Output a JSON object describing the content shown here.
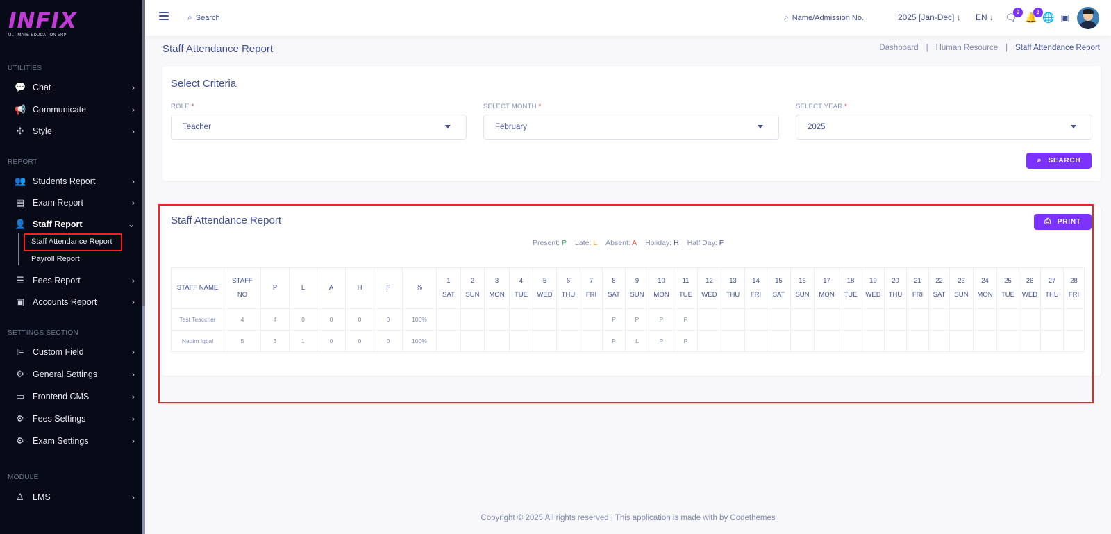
{
  "brand": {
    "logo": "INFIX",
    "tagline": "ULTIMATE EDUCATION ERP",
    "accent": "#7c32ff"
  },
  "sidebar": {
    "sections": {
      "utilities": "UTILITIES",
      "report": "REPORT",
      "settings": "SETTINGS SECTION",
      "module": "MODULE"
    },
    "items": [
      {
        "label": "Chat",
        "icon": "chat-icon"
      },
      {
        "label": "Communicate",
        "icon": "megaphone-icon"
      },
      {
        "label": "Style",
        "icon": "style-icon"
      },
      {
        "label": "Students Report",
        "icon": "users-icon"
      },
      {
        "label": "Exam Report",
        "icon": "book-icon"
      },
      {
        "label": "Staff Report",
        "icon": "user-icon"
      },
      {
        "label": "Fees Report",
        "icon": "fees-icon"
      },
      {
        "label": "Accounts Report",
        "icon": "money-icon"
      },
      {
        "label": "Custom Field",
        "icon": "custom-field-icon"
      },
      {
        "label": "General Settings",
        "icon": "gears-icon"
      },
      {
        "label": "Frontend CMS",
        "icon": "monitor-icon"
      },
      {
        "label": "Fees Settings",
        "icon": "gears-icon"
      },
      {
        "label": "Exam Settings",
        "icon": "gears-icon"
      },
      {
        "label": "LMS",
        "icon": "lms-icon"
      }
    ],
    "sub_items": [
      "Staff Attendance Report",
      "Payroll Report"
    ]
  },
  "topbar": {
    "search_label": "Search",
    "admission_search": "Name/Admission No.",
    "session": "2025 [Jan-Dec]",
    "language": "EN",
    "message_count": "0",
    "notification_count": "3"
  },
  "page": {
    "title": "Staff Attendance Report",
    "breadcrumb": [
      "Dashboard",
      "Human Resource",
      "Staff Attendance Report"
    ]
  },
  "criteria": {
    "title": "Select Criteria",
    "role_label": "ROLE",
    "role_value": "Teacher",
    "month_label": "SELECT MONTH",
    "month_value": "February",
    "year_label": "SELECT YEAR",
    "year_value": "2025",
    "required_mark": "*",
    "search_button": "SEARCH"
  },
  "report": {
    "title": "Staff Attendance Report",
    "print_button": "PRINT",
    "legend": [
      {
        "label": "Present:",
        "code": "P"
      },
      {
        "label": "Late:",
        "code": "L"
      },
      {
        "label": "Absent:",
        "code": "A"
      },
      {
        "label": "Holiday:",
        "code": "H"
      },
      {
        "label": "Half Day:",
        "code": "F"
      }
    ],
    "headers": [
      [
        "STAFF NAME"
      ],
      [
        "STAFF",
        "NO"
      ],
      [
        "P"
      ],
      [
        "L"
      ],
      [
        "A"
      ],
      [
        "H"
      ],
      [
        "F"
      ],
      [
        "%"
      ]
    ],
    "days": [
      [
        "1",
        "SAT"
      ],
      [
        "2",
        "SUN"
      ],
      [
        "3",
        "MON"
      ],
      [
        "4",
        "TUE"
      ],
      [
        "5",
        "WED"
      ],
      [
        "6",
        "THU"
      ],
      [
        "7",
        "FRI"
      ],
      [
        "8",
        "SAT"
      ],
      [
        "9",
        "SUN"
      ],
      [
        "10",
        "MON"
      ],
      [
        "11",
        "TUE"
      ],
      [
        "12",
        "WED"
      ],
      [
        "13",
        "THU"
      ],
      [
        "14",
        "FRI"
      ],
      [
        "15",
        "SAT"
      ],
      [
        "16",
        "SUN"
      ],
      [
        "17",
        "MON"
      ],
      [
        "18",
        "TUE"
      ],
      [
        "19",
        "WED"
      ],
      [
        "20",
        "THU"
      ],
      [
        "21",
        "FRI"
      ],
      [
        "22",
        "SAT"
      ],
      [
        "23",
        "SUN"
      ],
      [
        "24",
        "MON"
      ],
      [
        "25",
        "TUE"
      ],
      [
        "26",
        "WED"
      ],
      [
        "27",
        "THU"
      ],
      [
        "28",
        "FRI"
      ]
    ],
    "rows": [
      {
        "name": "Test Teaccher",
        "staff_no": "4",
        "p": "4",
        "l": "0",
        "a": "0",
        "h": "0",
        "f": "0",
        "pct": "100%",
        "days": [
          "",
          "",
          "",
          "",
          "",
          "",
          "",
          "P",
          "P",
          "P",
          "P",
          "",
          "",
          "",
          "",
          "",
          "",
          "",
          "",
          "",
          "",
          "",
          "",
          "",
          "",
          "",
          "",
          ""
        ]
      },
      {
        "name": "Nadim Iqbal",
        "staff_no": "5",
        "p": "3",
        "l": "1",
        "a": "0",
        "h": "0",
        "f": "0",
        "pct": "100%",
        "days": [
          "",
          "",
          "",
          "",
          "",
          "",
          "",
          "P",
          "L",
          "P",
          "P",
          "",
          "",
          "",
          "",
          "",
          "",
          "",
          "",
          "",
          "",
          "",
          "",
          "",
          "",
          "",
          "",
          ""
        ]
      }
    ]
  },
  "footer": "Copyright © 2025 All rights reserved | This application is made with by Codethemes"
}
